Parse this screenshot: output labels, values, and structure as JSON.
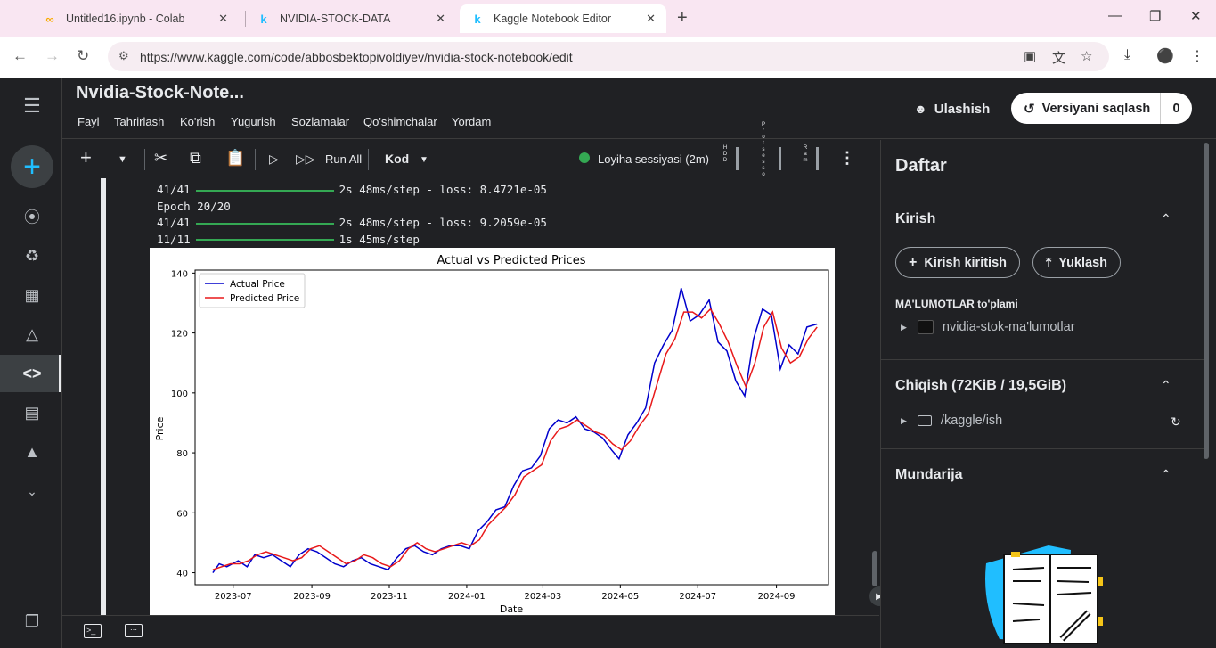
{
  "browser": {
    "tabs": [
      {
        "title": "Untitled16.ipynb - Colab",
        "favicon": "colab-icon"
      },
      {
        "title": "NVIDIA-STOCK-DATA",
        "favicon": "kaggle-icon"
      },
      {
        "title": "Kaggle Notebook Editor",
        "favicon": "kaggle-icon"
      }
    ],
    "url": "https://www.kaggle.com/code/abbosbektopivoldiyev/nvidia-stock-notebook/edit"
  },
  "header": {
    "title": "Nvidia-Stock-Note...",
    "menu": [
      "Fayl",
      "Tahrirlash",
      "Ko'rish",
      "Yugurish",
      "Sozlamalar",
      "Qo'shimchalar",
      "Yordam"
    ],
    "share_label": "Ulashish",
    "save_label": "Versiyani saqlash",
    "save_count": "0"
  },
  "toolbar": {
    "run_all": "Run All",
    "cell_type": "Kod",
    "session": "Loyiha sessiyasi (2m)",
    "hdd": "HDD",
    "processor": "Protsessor",
    "ram": "Ram"
  },
  "output": {
    "lines": [
      {
        "pre": "41/41",
        "post": "2s 48ms/step - loss: 8.4721e-05",
        "bar": true
      },
      {
        "pre": "Epoch 20/20",
        "post": "",
        "bar": false
      },
      {
        "pre": "41/41",
        "post": "2s 48ms/step - loss: 9.2059e-05",
        "bar": true
      },
      {
        "pre": "11/11",
        "post": "1s 45ms/step",
        "bar": true
      }
    ]
  },
  "chart_data": {
    "type": "line",
    "title": "Actual vs Predicted Prices",
    "xlabel": "Date",
    "ylabel": "Price",
    "ylim": [
      36,
      141
    ],
    "xlim": [
      "2023-06-01",
      "2024-10-12"
    ],
    "xticks": [
      "2023-07",
      "2023-09",
      "2023-11",
      "2024-01",
      "2024-03",
      "2024-05",
      "2024-07",
      "2024-09"
    ],
    "yticks": [
      40,
      60,
      80,
      100,
      120,
      140
    ],
    "legend": "top-left",
    "series": [
      {
        "name": "Actual Price",
        "color": "#0000cc",
        "points": [
          [
            "2023-06-15",
            40
          ],
          [
            "2023-06-20",
            43
          ],
          [
            "2023-06-26",
            42
          ],
          [
            "2023-07-05",
            44
          ],
          [
            "2023-07-12",
            42
          ],
          [
            "2023-07-18",
            46
          ],
          [
            "2023-07-25",
            45
          ],
          [
            "2023-08-01",
            46
          ],
          [
            "2023-08-08",
            44
          ],
          [
            "2023-08-15",
            42
          ],
          [
            "2023-08-22",
            46
          ],
          [
            "2023-08-29",
            48
          ],
          [
            "2023-09-05",
            47
          ],
          [
            "2023-09-12",
            45
          ],
          [
            "2023-09-19",
            43
          ],
          [
            "2023-09-26",
            42
          ],
          [
            "2023-10-03",
            44
          ],
          [
            "2023-10-10",
            45
          ],
          [
            "2023-10-17",
            43
          ],
          [
            "2023-10-24",
            42
          ],
          [
            "2023-10-31",
            41
          ],
          [
            "2023-11-07",
            45
          ],
          [
            "2023-11-14",
            48
          ],
          [
            "2023-11-21",
            49
          ],
          [
            "2023-11-28",
            47
          ],
          [
            "2023-12-05",
            46
          ],
          [
            "2023-12-12",
            48
          ],
          [
            "2023-12-19",
            49
          ],
          [
            "2023-12-27",
            49
          ],
          [
            "2024-01-03",
            48
          ],
          [
            "2024-01-10",
            54
          ],
          [
            "2024-01-17",
            57
          ],
          [
            "2024-01-24",
            61
          ],
          [
            "2024-01-31",
            62
          ],
          [
            "2024-02-07",
            69
          ],
          [
            "2024-02-14",
            74
          ],
          [
            "2024-02-21",
            75
          ],
          [
            "2024-02-28",
            79
          ],
          [
            "2024-03-06",
            88
          ],
          [
            "2024-03-13",
            91
          ],
          [
            "2024-03-20",
            90
          ],
          [
            "2024-03-27",
            92
          ],
          [
            "2024-04-03",
            88
          ],
          [
            "2024-04-10",
            87
          ],
          [
            "2024-04-17",
            85
          ],
          [
            "2024-04-24",
            81
          ],
          [
            "2024-04-30",
            78
          ],
          [
            "2024-05-07",
            86
          ],
          [
            "2024-05-14",
            90
          ],
          [
            "2024-05-21",
            95
          ],
          [
            "2024-05-28",
            110
          ],
          [
            "2024-06-04",
            116
          ],
          [
            "2024-06-11",
            121
          ],
          [
            "2024-06-18",
            135
          ],
          [
            "2024-06-25",
            124
          ],
          [
            "2024-07-02",
            126
          ],
          [
            "2024-07-10",
            131
          ],
          [
            "2024-07-17",
            117
          ],
          [
            "2024-07-24",
            114
          ],
          [
            "2024-07-31",
            104
          ],
          [
            "2024-08-07",
            99
          ],
          [
            "2024-08-14",
            118
          ],
          [
            "2024-08-21",
            128
          ],
          [
            "2024-08-28",
            126
          ],
          [
            "2024-09-04",
            108
          ],
          [
            "2024-09-11",
            116
          ],
          [
            "2024-09-18",
            113
          ],
          [
            "2024-09-25",
            122
          ],
          [
            "2024-10-03",
            123
          ]
        ]
      },
      {
        "name": "Predicted Price",
        "color": "#e8191a",
        "points": [
          [
            "2023-06-15",
            41
          ],
          [
            "2023-06-22",
            42
          ],
          [
            "2023-06-29",
            43
          ],
          [
            "2023-07-06",
            43
          ],
          [
            "2023-07-13",
            44
          ],
          [
            "2023-07-20",
            46
          ],
          [
            "2023-07-27",
            47
          ],
          [
            "2023-08-03",
            46
          ],
          [
            "2023-08-10",
            45
          ],
          [
            "2023-08-17",
            44
          ],
          [
            "2023-08-24",
            45
          ],
          [
            "2023-08-31",
            48
          ],
          [
            "2023-09-07",
            49
          ],
          [
            "2023-09-14",
            47
          ],
          [
            "2023-09-21",
            45
          ],
          [
            "2023-09-28",
            43
          ],
          [
            "2023-10-05",
            44
          ],
          [
            "2023-10-12",
            46
          ],
          [
            "2023-10-19",
            45
          ],
          [
            "2023-10-26",
            43
          ],
          [
            "2023-11-02",
            42
          ],
          [
            "2023-11-09",
            44
          ],
          [
            "2023-11-16",
            48
          ],
          [
            "2023-11-23",
            50
          ],
          [
            "2023-11-30",
            48
          ],
          [
            "2023-12-07",
            47
          ],
          [
            "2023-12-14",
            48
          ],
          [
            "2023-12-21",
            49
          ],
          [
            "2023-12-28",
            50
          ],
          [
            "2024-01-04",
            49
          ],
          [
            "2024-01-11",
            51
          ],
          [
            "2024-01-18",
            56
          ],
          [
            "2024-01-25",
            59
          ],
          [
            "2024-02-01",
            62
          ],
          [
            "2024-02-08",
            66
          ],
          [
            "2024-02-15",
            72
          ],
          [
            "2024-02-22",
            74
          ],
          [
            "2024-02-29",
            76
          ],
          [
            "2024-03-07",
            84
          ],
          [
            "2024-03-14",
            88
          ],
          [
            "2024-03-21",
            89
          ],
          [
            "2024-03-28",
            91
          ],
          [
            "2024-04-04",
            89
          ],
          [
            "2024-04-11",
            87
          ],
          [
            "2024-04-18",
            86
          ],
          [
            "2024-04-25",
            83
          ],
          [
            "2024-05-02",
            81
          ],
          [
            "2024-05-09",
            84
          ],
          [
            "2024-05-16",
            89
          ],
          [
            "2024-05-23",
            93
          ],
          [
            "2024-05-30",
            103
          ],
          [
            "2024-06-06",
            113
          ],
          [
            "2024-06-13",
            118
          ],
          [
            "2024-06-20",
            127
          ],
          [
            "2024-06-27",
            127
          ],
          [
            "2024-07-04",
            125
          ],
          [
            "2024-07-11",
            128
          ],
          [
            "2024-07-18",
            123
          ],
          [
            "2024-07-25",
            117
          ],
          [
            "2024-08-01",
            109
          ],
          [
            "2024-08-08",
            102
          ],
          [
            "2024-08-15",
            110
          ],
          [
            "2024-08-22",
            122
          ],
          [
            "2024-08-29",
            127
          ],
          [
            "2024-09-05",
            115
          ],
          [
            "2024-09-12",
            110
          ],
          [
            "2024-09-19",
            112
          ],
          [
            "2024-09-26",
            118
          ],
          [
            "2024-10-03",
            122
          ]
        ]
      }
    ]
  },
  "right_panel": {
    "title": "Daftar",
    "input_section": "Kirish",
    "add_input": "Kirish kiritish",
    "upload": "Yuklash",
    "datasets_label": "MA'LUMOTLAR to'plami",
    "dataset_item": "nvidia-stok-ma'lumotlar",
    "output_section": "Chiqish (72KiB / 19,5GiB)",
    "output_item": "/kaggle/ish",
    "toc_section": "Mundarija"
  }
}
